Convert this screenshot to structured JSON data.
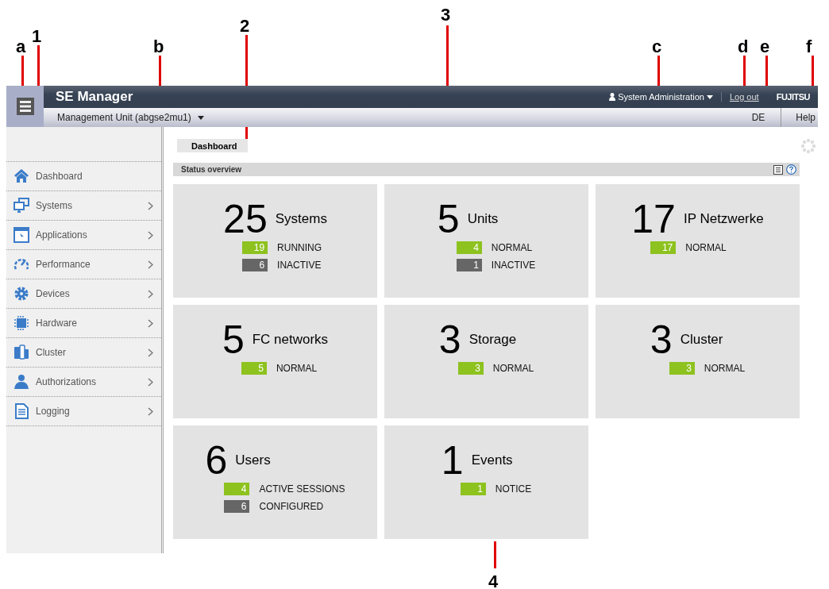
{
  "callouts": [
    {
      "label": "a"
    },
    {
      "label": "1"
    },
    {
      "label": "b"
    },
    {
      "label": "2"
    },
    {
      "label": "3"
    },
    {
      "label": "c"
    },
    {
      "label": "d"
    },
    {
      "label": "e"
    },
    {
      "label": "f"
    },
    {
      "label": "4"
    }
  ],
  "header": {
    "title": "SE Manager",
    "user": "System Administration",
    "logout": "Log out",
    "logo": "FUJITSU",
    "unit": "Management Unit (abgse2mu1)",
    "language": "DE",
    "help": "Help"
  },
  "sidebar": {
    "items": [
      {
        "label": "Dashboard",
        "expandable": false
      },
      {
        "label": "Systems",
        "expandable": true
      },
      {
        "label": "Applications",
        "expandable": true
      },
      {
        "label": "Performance",
        "expandable": true
      },
      {
        "label": "Devices",
        "expandable": true
      },
      {
        "label": "Hardware",
        "expandable": true
      },
      {
        "label": "Cluster",
        "expandable": true
      },
      {
        "label": "Authorizations",
        "expandable": true
      },
      {
        "label": "Logging",
        "expandable": true
      }
    ]
  },
  "breadcrumb": "Dashboard",
  "panel": {
    "title": "Status overview"
  },
  "tiles": [
    {
      "count": "25",
      "title": "Systems",
      "statuses": [
        {
          "count": "19",
          "label": "RUNNING",
          "color": "#8dc21f"
        },
        {
          "count": "6",
          "label": "INACTIVE",
          "color": "#666666"
        }
      ]
    },
    {
      "count": "5",
      "title": "Units",
      "statuses": [
        {
          "count": "4",
          "label": "NORMAL",
          "color": "#8dc21f"
        },
        {
          "count": "1",
          "label": "INACTIVE",
          "color": "#666666"
        }
      ]
    },
    {
      "count": "17",
      "title": "IP Netzwerke",
      "statuses": [
        {
          "count": "17",
          "label": "NORMAL",
          "color": "#8dc21f"
        }
      ]
    },
    {
      "count": "5",
      "title": "FC networks",
      "statuses": [
        {
          "count": "5",
          "label": "NORMAL",
          "color": "#8dc21f"
        }
      ]
    },
    {
      "count": "3",
      "title": "Storage",
      "statuses": [
        {
          "count": "3",
          "label": "NORMAL",
          "color": "#8dc21f"
        }
      ]
    },
    {
      "count": "3",
      "title": "Cluster",
      "statuses": [
        {
          "count": "3",
          "label": "NORMAL",
          "color": "#8dc21f"
        }
      ]
    },
    {
      "count": "6",
      "title": "Users",
      "statuses": [
        {
          "count": "4",
          "label": "ACTIVE SESSIONS",
          "color": "#8dc21f"
        },
        {
          "count": "6",
          "label": "CONFIGURED",
          "color": "#666666"
        }
      ]
    },
    {
      "count": "1",
      "title": "Events",
      "statuses": [
        {
          "count": "1",
          "label": "NOTICE",
          "color": "#8dc21f"
        }
      ]
    }
  ]
}
